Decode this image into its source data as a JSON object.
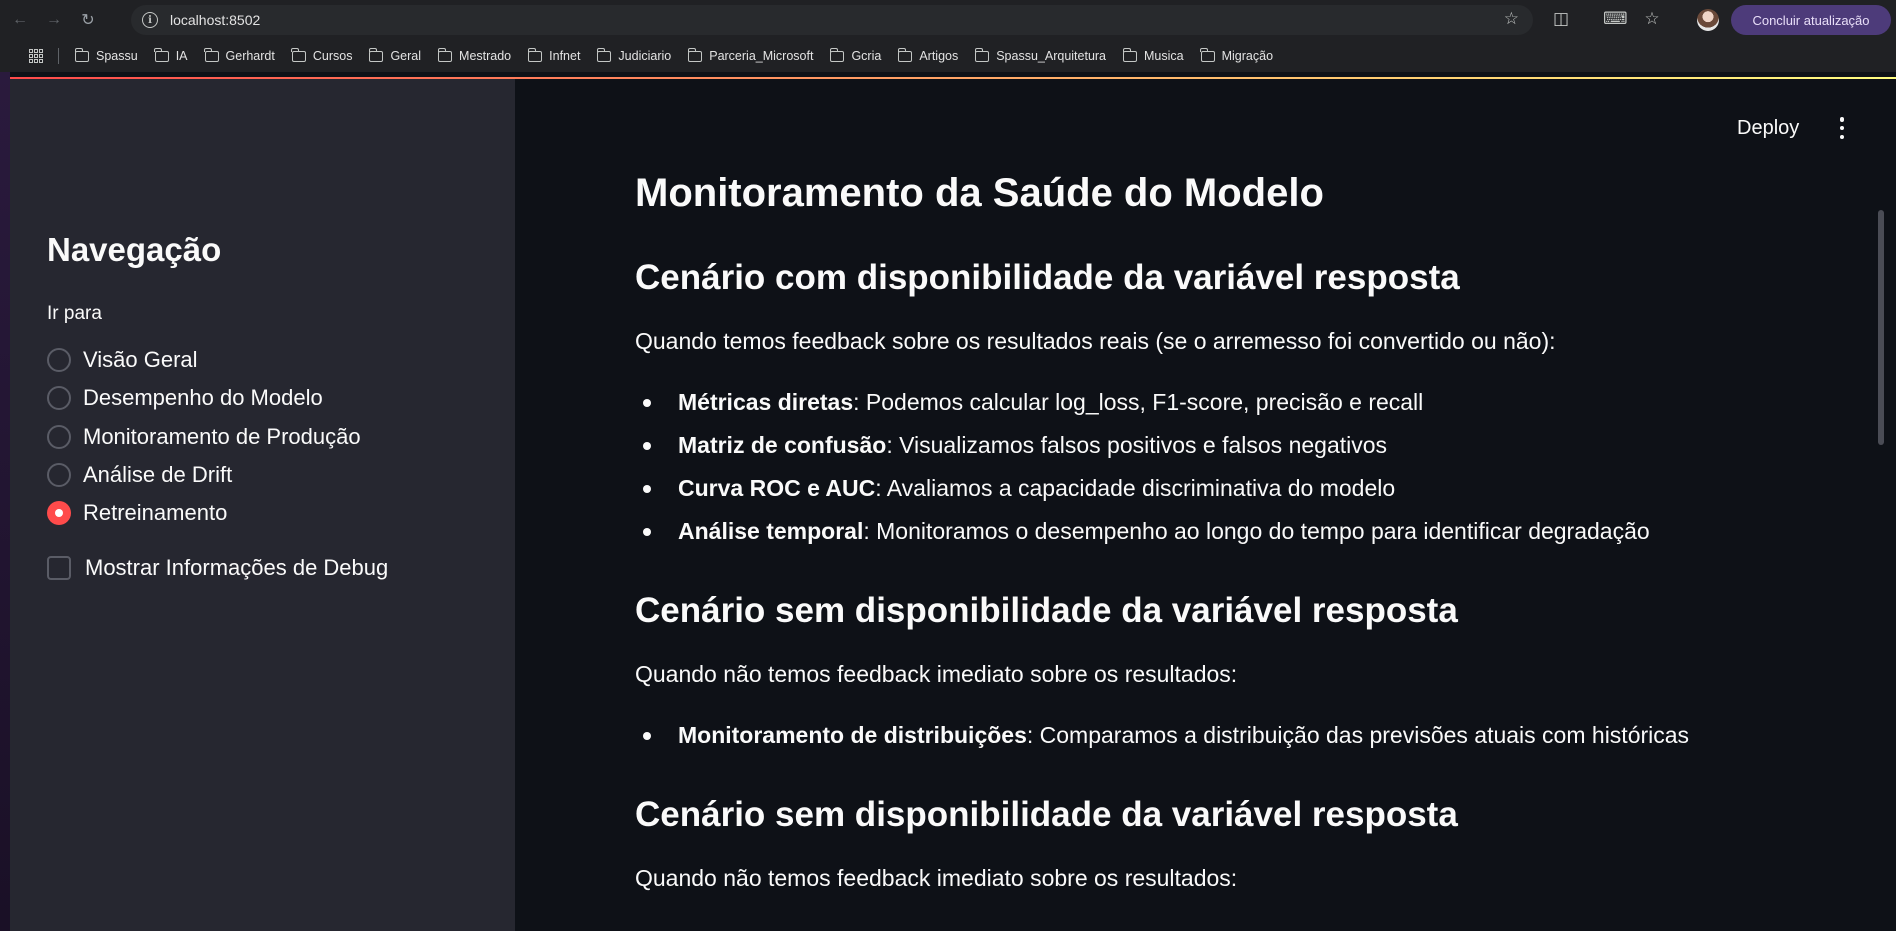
{
  "browser": {
    "url": "localhost:8502",
    "update_button": "Concluir atualização",
    "bookmarks": [
      "Spassu",
      "IA",
      "Gerhardt",
      "Cursos",
      "Geral",
      "Mestrado",
      "Infnet",
      "Judiciario",
      "Parceria_Microsoft",
      "Gcria",
      "Artigos",
      "Spassu_Arquitetura",
      "Musica",
      "Migração"
    ]
  },
  "header": {
    "deploy_label": "Deploy"
  },
  "sidebar": {
    "title": "Navegação",
    "radio_label": "Ir para",
    "options": [
      {
        "label": "Visão Geral",
        "selected": false
      },
      {
        "label": "Desempenho do Modelo",
        "selected": false
      },
      {
        "label": "Monitoramento de Produção",
        "selected": false
      },
      {
        "label": "Análise de Drift",
        "selected": false
      },
      {
        "label": "Retreinamento",
        "selected": true
      }
    ],
    "debug_checkbox": {
      "label": "Mostrar Informações de Debug",
      "checked": false
    }
  },
  "main": {
    "title": "Monitoramento da Saúde do Modelo",
    "section1": {
      "heading": "Cenário com disponibilidade da variável resposta",
      "intro": "Quando temos feedback sobre os resultados reais (se o arremesso foi convertido ou não):",
      "bullets": [
        {
          "bold": "Métricas diretas",
          "text": ": Podemos calcular log_loss, F1-score, precisão e recall"
        },
        {
          "bold": "Matriz de confusão",
          "text": ": Visualizamos falsos positivos e falsos negativos"
        },
        {
          "bold": "Curva ROC e AUC",
          "text": ": Avaliamos a capacidade discriminativa do modelo"
        },
        {
          "bold": "Análise temporal",
          "text": ": Monitoramos o desempenho ao longo do tempo para identificar degradação"
        }
      ]
    },
    "section2": {
      "heading": "Cenário sem disponibilidade da variável resposta",
      "intro": "Quando não temos feedback imediato sobre os resultados:",
      "bullets": [
        {
          "bold": "Monitoramento de distribuições",
          "text": ": Comparamos a distribuição das previsões atuais com históricas"
        }
      ]
    },
    "section3": {
      "heading": "Cenário sem disponibilidade da variável resposta",
      "intro": "Quando não temos feedback imediato sobre os resultados:"
    }
  },
  "colors": {
    "accent": "#ff4b4b",
    "sidebar_bg": "#262730",
    "main_bg": "#0e1117"
  }
}
